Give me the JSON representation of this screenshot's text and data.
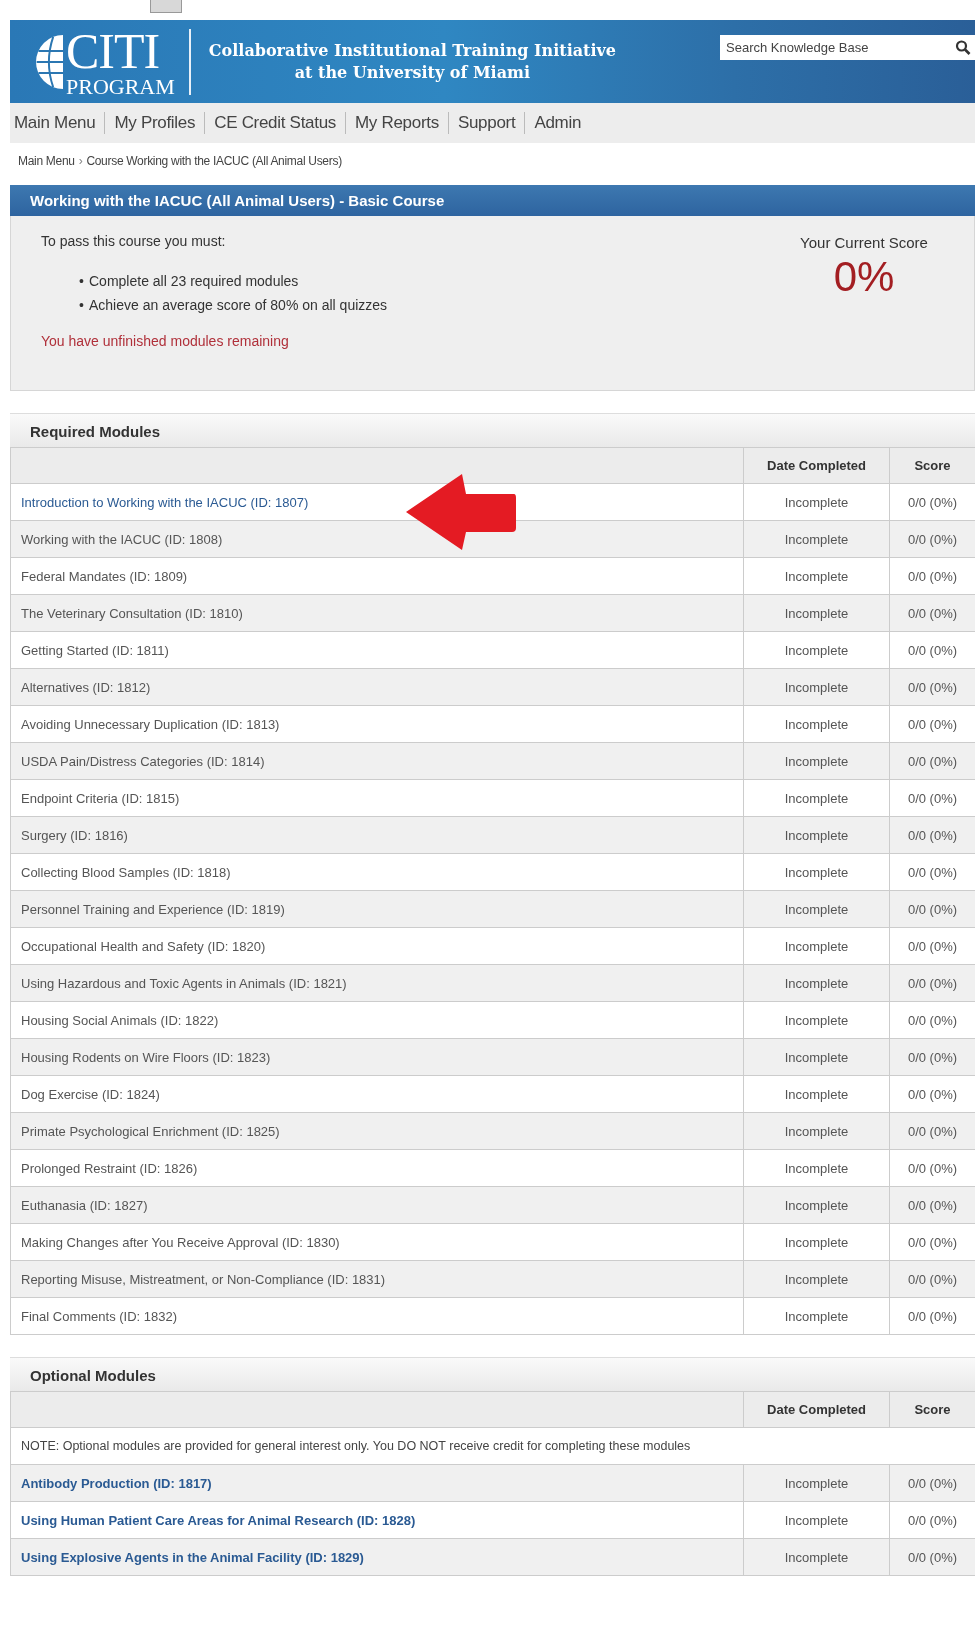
{
  "header": {
    "logo_title": "CITI",
    "logo_subtitle": "PROGRAM",
    "tagline": [
      "Collaborative Institutional Training Initiative",
      "at the University of Miami"
    ],
    "search": {
      "placeholder": "Search Knowledge Base"
    }
  },
  "nav": [
    "Main Menu",
    "My Profiles",
    "CE Credit Status",
    "My Reports",
    "Support",
    "Admin"
  ],
  "breadcrumb": {
    "items": [
      "Main Menu",
      "Course Working with the IACUC (All Animal Users)"
    ],
    "separator": "›"
  },
  "course": {
    "title": "Working with the IACUC (All Animal Users) - Basic Course",
    "requirements_intro": "To pass this course you must:",
    "bullet": "•",
    "requirements": [
      "Complete all 23 required modules",
      "Achieve an average score of 80% on all quizzes"
    ],
    "warning": "You have unfinished modules remaining",
    "score_label": "Your Current Score",
    "score": "0%"
  },
  "required_modules": {
    "title": "Required Modules",
    "columns": [
      "Date Completed",
      "Score"
    ],
    "rows": [
      {
        "name": "Introduction to Working with the IACUC (ID: 1807)",
        "date": "Incomplete",
        "score": "0/0 (0%)",
        "disabled": false
      },
      {
        "name": "Working with the IACUC (ID: 1808)",
        "date": "Incomplete",
        "score": "0/0 (0%)",
        "disabled": true
      },
      {
        "name": "Federal Mandates (ID: 1809)",
        "date": "Incomplete",
        "score": "0/0 (0%)",
        "disabled": true
      },
      {
        "name": "The Veterinary Consultation (ID: 1810)",
        "date": "Incomplete",
        "score": "0/0 (0%)",
        "disabled": true
      },
      {
        "name": "Getting Started (ID: 1811)",
        "date": "Incomplete",
        "score": "0/0 (0%)",
        "disabled": true
      },
      {
        "name": "Alternatives (ID: 1812)",
        "date": "Incomplete",
        "score": "0/0 (0%)",
        "disabled": true
      },
      {
        "name": "Avoiding Unnecessary Duplication (ID: 1813)",
        "date": "Incomplete",
        "score": "0/0 (0%)",
        "disabled": true
      },
      {
        "name": "USDA Pain/Distress Categories (ID: 1814)",
        "date": "Incomplete",
        "score": "0/0 (0%)",
        "disabled": true
      },
      {
        "name": "Endpoint Criteria (ID: 1815)",
        "date": "Incomplete",
        "score": "0/0 (0%)",
        "disabled": true
      },
      {
        "name": "Surgery (ID: 1816)",
        "date": "Incomplete",
        "score": "0/0 (0%)",
        "disabled": true
      },
      {
        "name": "Collecting Blood Samples (ID: 1818)",
        "date": "Incomplete",
        "score": "0/0 (0%)",
        "disabled": true
      },
      {
        "name": "Personnel Training and Experience (ID: 1819)",
        "date": "Incomplete",
        "score": "0/0 (0%)",
        "disabled": true
      },
      {
        "name": "Occupational Health and Safety (ID: 1820)",
        "date": "Incomplete",
        "score": "0/0 (0%)",
        "disabled": true
      },
      {
        "name": "Using Hazardous and Toxic Agents in Animals (ID: 1821)",
        "date": "Incomplete",
        "score": "0/0 (0%)",
        "disabled": true
      },
      {
        "name": "Housing Social Animals (ID: 1822)",
        "date": "Incomplete",
        "score": "0/0 (0%)",
        "disabled": true
      },
      {
        "name": "Housing Rodents on Wire Floors (ID: 1823)",
        "date": "Incomplete",
        "score": "0/0 (0%)",
        "disabled": true
      },
      {
        "name": "Dog Exercise (ID: 1824)",
        "date": "Incomplete",
        "score": "0/0 (0%)",
        "disabled": true
      },
      {
        "name": "Primate Psychological Enrichment (ID: 1825)",
        "date": "Incomplete",
        "score": "0/0 (0%)",
        "disabled": true
      },
      {
        "name": "Prolonged Restraint (ID: 1826)",
        "date": "Incomplete",
        "score": "0/0 (0%)",
        "disabled": true
      },
      {
        "name": "Euthanasia (ID: 1827)",
        "date": "Incomplete",
        "score": "0/0 (0%)",
        "disabled": true
      },
      {
        "name": "Making Changes after You Receive Approval (ID: 1830)",
        "date": "Incomplete",
        "score": "0/0 (0%)",
        "disabled": true
      },
      {
        "name": "Reporting Misuse, Mistreatment, or Non-Compliance (ID: 1831)",
        "date": "Incomplete",
        "score": "0/0 (0%)",
        "disabled": true
      },
      {
        "name": "Final Comments (ID: 1832)",
        "date": "Incomplete",
        "score": "0/0 (0%)",
        "disabled": true
      }
    ]
  },
  "optional_modules": {
    "title": "Optional Modules",
    "columns": [
      "Date Completed",
      "Score"
    ],
    "note": "NOTE: Optional modules are provided for general interest only. You DO NOT receive credit for completing these modules",
    "rows": [
      {
        "name": "Antibody Production (ID: 1817)",
        "date": "Incomplete",
        "score": "0/0 (0%)"
      },
      {
        "name": "Using Human Patient Care Areas for Animal Research (ID: 1828)",
        "date": "Incomplete",
        "score": "0/0 (0%)"
      },
      {
        "name": "Using Explosive Agents in the Animal Facility (ID: 1829)",
        "date": "Incomplete",
        "score": "0/0 (0%)"
      }
    ]
  }
}
